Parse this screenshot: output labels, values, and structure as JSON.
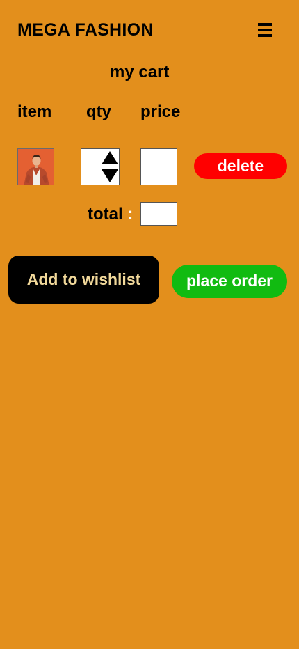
{
  "header": {
    "brand": "MEGA FASHION",
    "menu_icon": "hamburger-menu-icon"
  },
  "cart": {
    "title": "my cart",
    "columns": {
      "item": "item",
      "qty": "qty",
      "price": "price"
    },
    "row": {
      "thumbnail": "product-thumbnail",
      "qty_value": "",
      "price_value": "",
      "delete_label": "delete"
    },
    "total_label": "total",
    "total_colon": ":",
    "total_value": ""
  },
  "actions": {
    "wishlist_label": "Add to wishlist",
    "order_label": "place order"
  },
  "colors": {
    "background": "#E38F1C",
    "delete": "#FF0000",
    "order": "#11BB11",
    "wishlist_bg": "#000000",
    "wishlist_text": "#F1D89A"
  }
}
